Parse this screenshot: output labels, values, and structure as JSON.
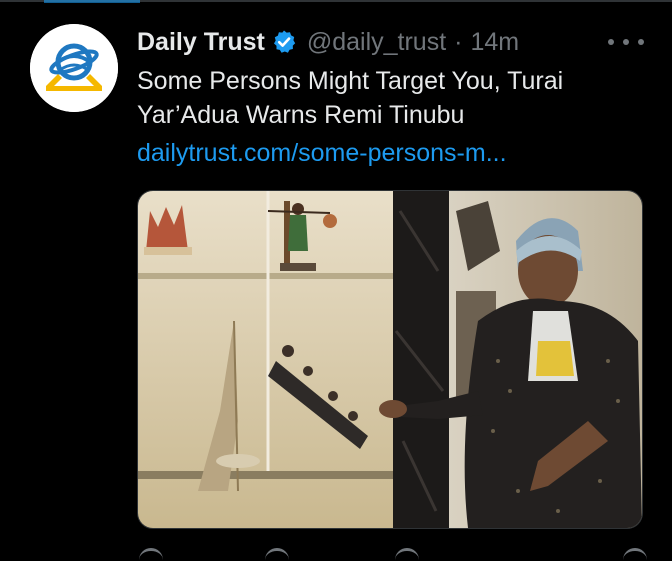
{
  "tweet": {
    "author_name": "Daily Trust",
    "handle": "@daily_trust",
    "separator": "·",
    "time": "14m",
    "text_lines": [
      "Some Persons Might Target You, Turai",
      "Yar’Adua Warns Remi Tinubu"
    ],
    "link": "dailytrust.com/some-persons-m..."
  },
  "icons": {
    "avatar": "daily-trust-logo",
    "verified": "verified-badge-icon",
    "more": "more-options-icon"
  },
  "colors": {
    "background": "#000000",
    "primary_text": "#e7e9ea",
    "secondary_text": "#71767b",
    "link": "#1d9bf0",
    "verified": "#1d9bf0",
    "logo_blue": "#1f78c1",
    "logo_yellow": "#f5b800"
  }
}
